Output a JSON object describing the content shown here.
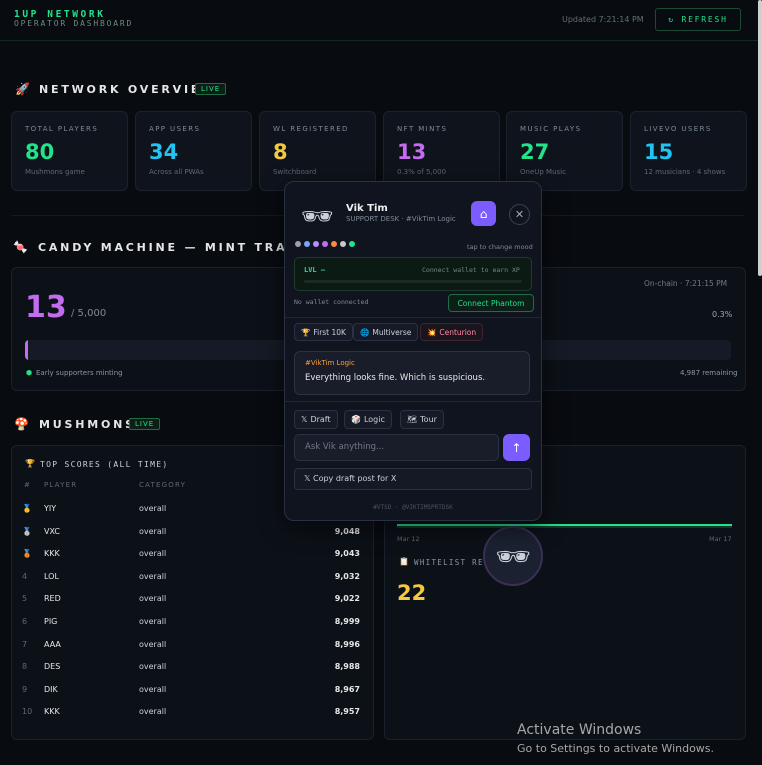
{
  "header": {
    "brand_title": "1UP NETWORK",
    "brand_subtitle": "OPERATOR DASHBOARD",
    "updated": "Updated 7:21:14 PM",
    "refresh_label": "↻ REFRESH"
  },
  "overview": {
    "title": "NETWORK OVERVIEW",
    "badge": "LIVE",
    "cards": [
      {
        "label": "TOTAL PLAYERS",
        "value": "80",
        "sub": "Mushmons game",
        "color": "#22e28a"
      },
      {
        "label": "APP USERS",
        "value": "34",
        "sub": "Across all PWAs",
        "color": "#22c3f0"
      },
      {
        "label": "WL REGISTERED",
        "value": "8",
        "sub": "Switchboard",
        "color": "#f5c842"
      },
      {
        "label": "NFT MINTS",
        "value": "13",
        "sub": "0.3% of 5,000",
        "color": "#c46cf0"
      },
      {
        "label": "MUSIC PLAYS",
        "value": "27",
        "sub": "OneUp Music",
        "color": "#22e28a"
      },
      {
        "label": "LIVEVO USERS",
        "value": "15",
        "sub": "12 musicians · 4 shows",
        "color": "#22c3f0"
      }
    ]
  },
  "candy": {
    "title": "CANDY MACHINE — MINT TRACKER",
    "minted": "13",
    "supply": "/ 5,000",
    "onchain": "On-chain · 7:21:15 PM",
    "percent": "0.3%",
    "progress": 0.003,
    "status": "Early supporters minting",
    "remaining": "4,987 remaining"
  },
  "mushmons": {
    "title": "MUSHMONS",
    "badge": "LIVE",
    "top_title": "TOP SCORES (ALL TIME)",
    "col_rank": "#",
    "col_player": "PLAYER",
    "col_category": "CATEGORY",
    "rows": [
      {
        "rank": "🥇",
        "player": "YIY",
        "category": "overall",
        "score": ""
      },
      {
        "rank": "🥈",
        "player": "VXC",
        "category": "overall",
        "score": "9,048"
      },
      {
        "rank": "🥉",
        "player": "KKK",
        "category": "overall",
        "score": "9,043"
      },
      {
        "rank": "4",
        "player": "LOL",
        "category": "overall",
        "score": "9,032"
      },
      {
        "rank": "5",
        "player": "RED",
        "category": "overall",
        "score": "9,022"
      },
      {
        "rank": "6",
        "player": "PIG",
        "category": "overall",
        "score": "8,999"
      },
      {
        "rank": "7",
        "player": "AAA",
        "category": "overall",
        "score": "8,996"
      },
      {
        "rank": "8",
        "player": "DES",
        "category": "overall",
        "score": "8,988"
      },
      {
        "rank": "9",
        "player": "DIK",
        "category": "overall",
        "score": "8,967"
      },
      {
        "rank": "10",
        "player": "KKK",
        "category": "overall",
        "score": "8,957"
      }
    ]
  },
  "trend": {
    "x_start": "Mar 12",
    "x_end": "Mar 17",
    "wl_title": "WHITELIST RE",
    "wl_value": "22"
  },
  "popup": {
    "name": "Vik Tim",
    "role": "SUPPORT DESK · #VikTim Logic",
    "mood_hint": "tap to change mood",
    "mood_colors": [
      "#a0a0a0",
      "#7aa2ff",
      "#b98cff",
      "#c46cf0",
      "#ff8a3d",
      "#c9c9c9",
      "#22e28a"
    ],
    "level": "LVL —",
    "xp_hint": "Connect wallet to earn XP",
    "wallet_status": "No wallet connected",
    "connect_label": "Connect Phantom",
    "chips": [
      {
        "icon": "🏆",
        "label": "First 10K"
      },
      {
        "icon": "🌐",
        "label": "Multiverse"
      },
      {
        "icon": "💥",
        "label": "Centurion"
      }
    ],
    "bubble_tag": "#VikTim Logic",
    "bubble_text": "Everything looks fine. Which is suspicious.",
    "tools": [
      {
        "icon": "𝕏",
        "label": "Draft"
      },
      {
        "icon": "🎲",
        "label": "Logic"
      },
      {
        "icon": "🗺",
        "label": "Tour"
      }
    ],
    "input_placeholder": "Ask Vik anything...",
    "copy_label": "𝕏  Copy draft post for X",
    "footer": "#VTSD · @VIKTIMSPRTDSK"
  },
  "watermark": {
    "line1": "Activate Windows",
    "line2": "Go to Settings to activate Windows."
  }
}
